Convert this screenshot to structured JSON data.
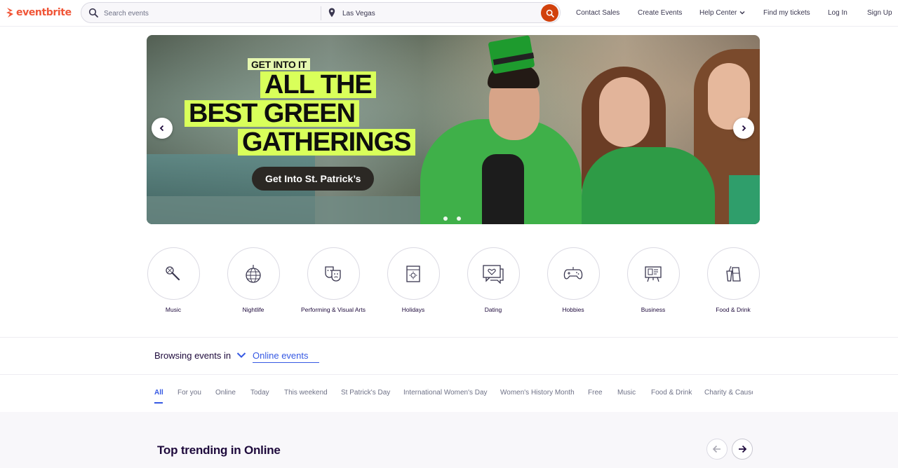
{
  "header": {
    "logo_text": "eventbrite",
    "search": {
      "placeholder": "Search events",
      "location_value": "Las Vegas"
    },
    "nav": {
      "contact_sales": "Contact Sales",
      "create_events": "Create Events",
      "help_center": "Help Center",
      "find_tickets": "Find my tickets",
      "log_in": "Log In",
      "sign_up": "Sign Up"
    }
  },
  "hero": {
    "kicker": "GET INTO IT",
    "line1": "ALL THE",
    "line2": "BEST GREEN",
    "line3": "GATHERINGS",
    "cta": "Get Into St. Patrick’s"
  },
  "categories": [
    {
      "label": "Music",
      "icon": "microphone-icon"
    },
    {
      "label": "Nightlife",
      "icon": "disco-ball-icon"
    },
    {
      "label": "Performing & Visual Arts",
      "icon": "theater-masks-icon"
    },
    {
      "label": "Holidays",
      "icon": "calendar-icon"
    },
    {
      "label": "Dating",
      "icon": "chat-heart-icon"
    },
    {
      "label": "Hobbies",
      "icon": "gamepad-icon"
    },
    {
      "label": "Business",
      "icon": "presentation-board-icon"
    },
    {
      "label": "Food & Drink",
      "icon": "drinks-icon"
    }
  ],
  "browsing": {
    "label": "Browsing events in",
    "value": "Online events"
  },
  "tabs": [
    "All",
    "For you",
    "Online",
    "Today",
    "This weekend",
    "St Patrick's Day",
    "International Women's Day",
    "Women's History Month",
    "Free",
    "Music",
    "Food & Drink",
    "Charity & Causes"
  ],
  "trending": {
    "title": "Top trending in Online"
  },
  "colors": {
    "brand": "#f05537",
    "search_button": "#d1410c",
    "link_blue": "#3659e3",
    "hero_highlight": "#d9ff5a"
  }
}
